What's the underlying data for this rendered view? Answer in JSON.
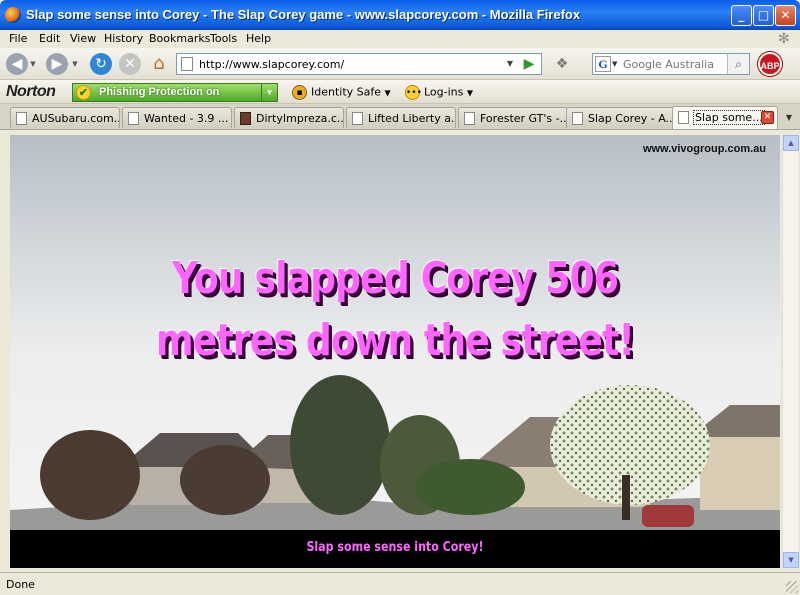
{
  "window": {
    "title": "Slap some sense into Corey - The Slap Corey game - www.slapcorey.com - Mozilla Firefox",
    "minimize": "_",
    "maximize": "□",
    "close": "✕"
  },
  "menu": [
    "File",
    "Edit",
    "View",
    "History",
    "Bookmarks",
    "Tools",
    "Help"
  ],
  "nav": {
    "url": "http://www.slapcorey.com/",
    "search_placeholder": "Google Australia",
    "search_engine_glyph": "G",
    "abp_label": "ABP"
  },
  "norton": {
    "logo": "Norton",
    "phishing": "Phishing Protection on",
    "identity_safe": "Identity Safe",
    "logins": "Log-ins"
  },
  "tabs": [
    {
      "label": "AUSubaru.com...",
      "icon": "page-icon"
    },
    {
      "label": "Wanted - 3.9 ...",
      "icon": "page-icon"
    },
    {
      "label": "DirtyImpreza.c...",
      "icon": "site-icon"
    },
    {
      "label": "Lifted Liberty a...",
      "icon": "page-icon"
    },
    {
      "label": "Forester GT's -...",
      "icon": "page-icon"
    },
    {
      "label": "Slap Corey - A...",
      "icon": "page-icon"
    },
    {
      "label": "Slap some...",
      "icon": "page-icon",
      "active": true
    }
  ],
  "game": {
    "site": "www.vivogroup.com.au",
    "headline_line1": "You slapped Corey 506",
    "headline_line2": "metres down the street!",
    "distance_metres": 506,
    "footer": "Slap some sense into Corey!",
    "accent_color": "#ff66ff"
  },
  "status": "Done"
}
